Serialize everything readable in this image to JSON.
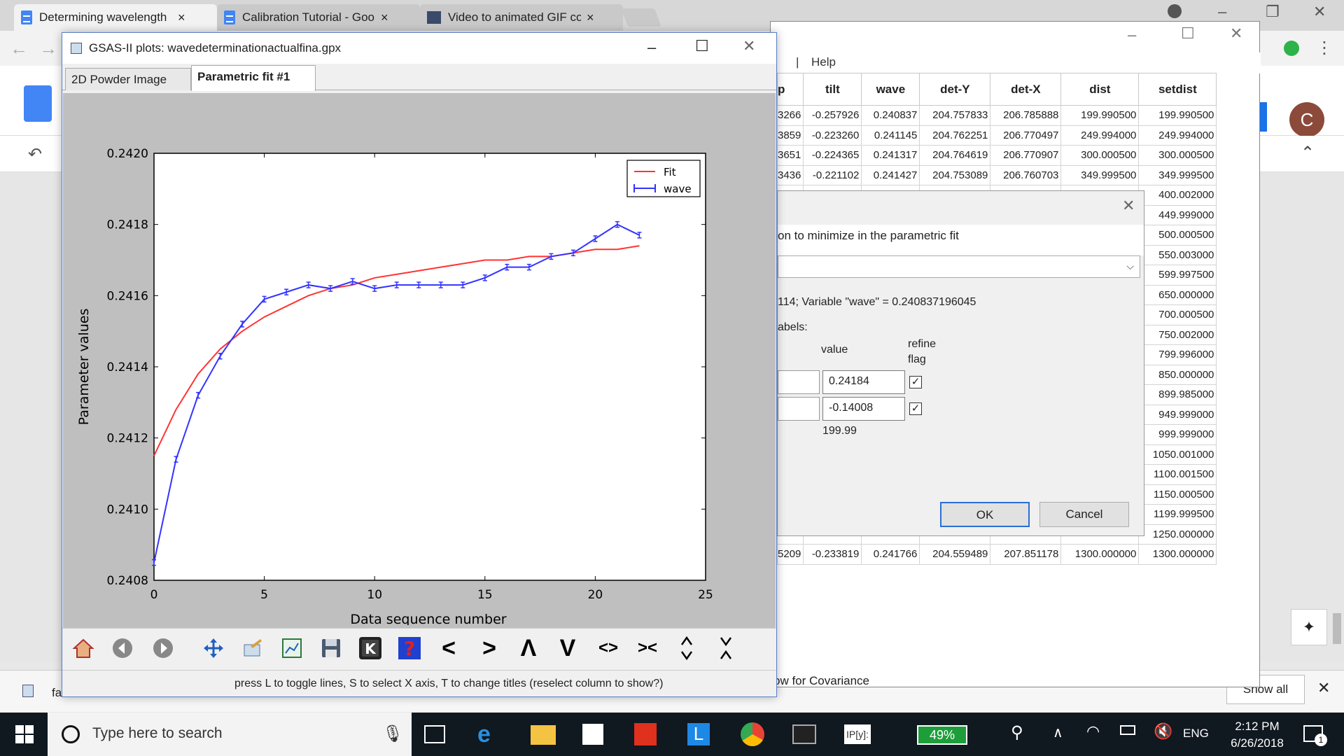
{
  "browser": {
    "tabs": [
      {
        "title": "Determining wavelength"
      },
      {
        "title": "Calibration Tutorial - Goo"
      },
      {
        "title": "Video to animated GIF co"
      }
    ],
    "avatar_letter": "C",
    "download_file": "fa"
  },
  "table_window": {
    "menu_help": "Help",
    "columns": [
      "p",
      "tilt",
      "wave",
      "det-Y",
      "det-X",
      "dist",
      "setdist"
    ],
    "rows": [
      [
        "3266",
        "-0.257926",
        "0.240837",
        "204.757833",
        "206.785888",
        "199.990500",
        "199.990500"
      ],
      [
        "3859",
        "-0.223260",
        "0.241145",
        "204.762251",
        "206.770497",
        "249.994000",
        "249.994000"
      ],
      [
        "3651",
        "-0.224365",
        "0.241317",
        "204.764619",
        "206.770907",
        "300.000500",
        "300.000500"
      ],
      [
        "3436",
        "-0.221102",
        "0.241427",
        "204.753089",
        "206.760703",
        "349.999500",
        "349.999500"
      ],
      [
        "",
        "",
        "",
        "",
        "",
        "",
        "400.002000"
      ],
      [
        "",
        "",
        "",
        "",
        "",
        "",
        "449.999000"
      ],
      [
        "",
        "",
        "",
        "",
        "",
        "",
        "500.000500"
      ],
      [
        "",
        "",
        "",
        "",
        "",
        "",
        "550.003000"
      ],
      [
        "",
        "",
        "",
        "",
        "",
        "",
        "599.997500"
      ],
      [
        "",
        "",
        "",
        "",
        "",
        "",
        "650.000000"
      ],
      [
        "",
        "",
        "",
        "",
        "",
        "",
        "700.000500"
      ],
      [
        "",
        "",
        "",
        "",
        "",
        "",
        "750.002000"
      ],
      [
        "",
        "",
        "",
        "",
        "",
        "",
        "799.996000"
      ],
      [
        "",
        "",
        "",
        "",
        "",
        "",
        "850.000000"
      ],
      [
        "",
        "",
        "",
        "",
        "",
        "",
        "899.985000"
      ],
      [
        "",
        "",
        "",
        "",
        "",
        "",
        "949.999000"
      ],
      [
        "",
        "",
        "",
        "",
        "",
        "",
        "999.999000"
      ],
      [
        "",
        "",
        "",
        "",
        "",
        "",
        "1050.001000"
      ],
      [
        "",
        "",
        "",
        "",
        "",
        "",
        "1100.001500"
      ],
      [
        "",
        "",
        "",
        "",
        "",
        "",
        "1150.000500"
      ],
      [
        "",
        "",
        "",
        "",
        "",
        "",
        "1199.999500"
      ],
      [
        "",
        "",
        "",
        "",
        "",
        "",
        "1250.000000"
      ],
      [
        "5209",
        "-0.233819",
        "0.241766",
        "204.559489",
        "207.851178",
        "1300.000000",
        "1300.000000"
      ]
    ],
    "covariance_text": "ow for Covariance",
    "show_all": "Show all"
  },
  "dialog": {
    "prompt": "on to minimize in the parametric fit",
    "info": "114; Variable \"wave\" = 0.240837196045",
    "labels_title": "abels:",
    "col_value": "value",
    "col_refine": "refine",
    "col_flag": "flag",
    "values": [
      "0.24184",
      "-0.14008"
    ],
    "extra_value": "199.99",
    "ok": "OK",
    "cancel": "Cancel"
  },
  "plot_window": {
    "title": "GSAS-II plots: wavedeterminationactualfina.gpx",
    "tabs": [
      "2D Powder Image",
      "Parametric fit #1"
    ],
    "status": "press L to toggle lines, S to select X axis, T to change titles (reselect column to show?)",
    "toolbar_glyphs": [
      "<",
      ">",
      "Λ",
      "V",
      "<>",
      "><"
    ]
  },
  "chart_data": {
    "type": "line",
    "xlabel": "Data sequence number",
    "ylabel": "Parameter values",
    "xlim": [
      0,
      25
    ],
    "ylim": [
      0.2408,
      0.242
    ],
    "xticks": [
      "0",
      "5",
      "10",
      "15",
      "20",
      "25"
    ],
    "yticks": [
      "0.2408",
      "0.2410",
      "0.2412",
      "0.2414",
      "0.2416",
      "0.2418",
      "0.2420"
    ],
    "legend_position": "top-right",
    "series": [
      {
        "name": "Fit",
        "color": "#ff3333",
        "x": [
          0,
          1,
          2,
          3,
          4,
          5,
          6,
          7,
          8,
          9,
          10,
          11,
          12,
          13,
          14,
          15,
          16,
          17,
          18,
          19,
          20,
          21,
          22
        ],
        "values": [
          0.24115,
          0.24128,
          0.24138,
          0.24145,
          0.2415,
          0.24154,
          0.24157,
          0.2416,
          0.24162,
          0.24163,
          0.24165,
          0.24166,
          0.24167,
          0.24168,
          0.24169,
          0.2417,
          0.2417,
          0.24171,
          0.24171,
          0.24172,
          0.24173,
          0.24173,
          0.24174
        ]
      },
      {
        "name": "wave",
        "color": "#3333ff",
        "x": [
          0,
          1,
          2,
          3,
          4,
          5,
          6,
          7,
          8,
          9,
          10,
          11,
          12,
          13,
          14,
          15,
          16,
          17,
          18,
          19,
          20,
          21,
          22
        ],
        "values": [
          0.24085,
          0.24114,
          0.24132,
          0.24143,
          0.24152,
          0.24159,
          0.24161,
          0.24163,
          0.24162,
          0.24164,
          0.24162,
          0.24163,
          0.24163,
          0.24163,
          0.24163,
          0.24165,
          0.24168,
          0.24168,
          0.24171,
          0.24172,
          0.24176,
          0.2418,
          0.24177
        ]
      }
    ]
  },
  "taskbar": {
    "search_placeholder": "Type here to search",
    "battery": "49%",
    "language": "ENG",
    "time": "2:12 PM",
    "date": "6/26/2018",
    "notif_count": "1"
  }
}
